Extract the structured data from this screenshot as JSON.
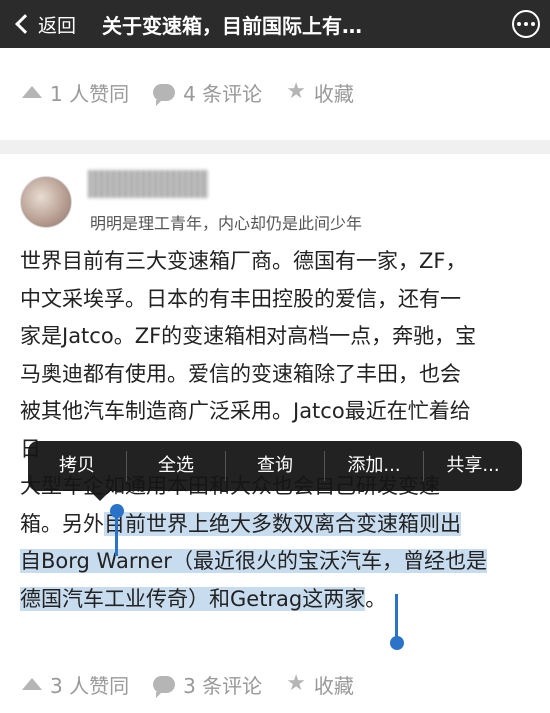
{
  "nav": {
    "back_label": "返回",
    "title": "关于变速箱，目前国际上有…",
    "more_icon": "more-icon"
  },
  "top_actions": {
    "agree": "1 人赞同",
    "comments": "4 条评论",
    "favorite": "收藏"
  },
  "answer": {
    "username": "",
    "bio": "明明是理工青年，内心却仍是此间少年",
    "lines": [
      "世界目前有三大变速箱厂商。德国有一家，ZF，",
      "中文采埃孚。日本的有丰田控股的爱信，还有一",
      "家是Jatco。ZF的变速箱相对高档一点，奔驰，宝",
      "马奥迪都有使用。爱信的变速箱除了丰田，也会",
      "被其他汽车制造商广泛采用。Jatco最近在忙着给",
      "日",
      "大型车企如通用本田和大众也会自己研发变速",
      "箱。另外",
      "目前世界上绝大多数双离合变速箱则出",
      "自Borg Warner（最近很火的宝沃汽车，曾经也是",
      "德国汽车工业传奇）和Getrag这两家",
      "。"
    ]
  },
  "popup_menu": {
    "copy": "拷贝",
    "select_all": "全选",
    "lookup": "查询",
    "add": "添加...",
    "share": "共享..."
  },
  "bottom_actions": {
    "agree": "3 人赞同",
    "comments": "3 条评论",
    "favorite": "收藏"
  },
  "colors": {
    "navbar": "#2b2b2b",
    "selection": "#c8dcef",
    "handle": "#2a73c9",
    "icon_gray": "#b5b5b5"
  }
}
